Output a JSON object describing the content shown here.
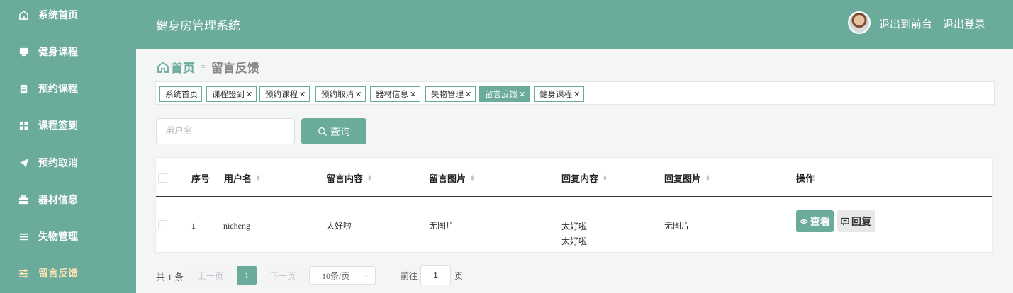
{
  "sidebar": {
    "items": [
      {
        "label": "系统首页",
        "icon": "home-icon"
      },
      {
        "label": "健身课程",
        "icon": "monitor-icon"
      },
      {
        "label": "预约课程",
        "icon": "clipboard-icon"
      },
      {
        "label": "课程签到",
        "icon": "grid-icon"
      },
      {
        "label": "预约取消",
        "icon": "send-icon"
      },
      {
        "label": "器材信息",
        "icon": "toolbox-icon"
      },
      {
        "label": "失物管理",
        "icon": "list-icon"
      },
      {
        "label": "留言反馈",
        "icon": "sliders-icon",
        "active": true
      }
    ]
  },
  "header": {
    "title": "健身房管理系统",
    "front_link": "退出到前台",
    "logout_link": "退出登录"
  },
  "breadcrumb": {
    "home": "首页",
    "current": "留言反馈"
  },
  "tags": [
    {
      "label": "系统首页",
      "closable": false
    },
    {
      "label": "课程签到",
      "closable": true
    },
    {
      "label": "预约课程",
      "closable": true
    },
    {
      "label": "预约取消",
      "closable": true
    },
    {
      "label": "器材信息",
      "closable": true
    },
    {
      "label": "失物管理",
      "closable": true
    },
    {
      "label": "留言反馈",
      "closable": true,
      "active": true
    },
    {
      "label": "健身课程",
      "closable": true
    }
  ],
  "search": {
    "placeholder": "用户名",
    "button_label": "查询"
  },
  "table": {
    "columns": [
      "序号",
      "用户名",
      "留言内容",
      "留言图片",
      "回复内容",
      "回复图片",
      "操作"
    ],
    "rows": [
      {
        "index": "1",
        "username": "nicheng",
        "content": "太好啦",
        "image": "无图片",
        "reply_lines": [
          "太好啦",
          "太好啦"
        ],
        "reply_image": "无图片"
      }
    ],
    "actions": {
      "view": "查看",
      "reply": "回复"
    }
  },
  "pagination": {
    "total": "共 1 条",
    "prev": "上一页",
    "current_page": "1",
    "next": "下一页",
    "page_size": "10条/页",
    "goto_label": "前往",
    "goto_value": "1",
    "page_suffix": "页"
  },
  "colors": {
    "primary": "#6aab9c",
    "active_menu_text": "#ffe5b4"
  }
}
